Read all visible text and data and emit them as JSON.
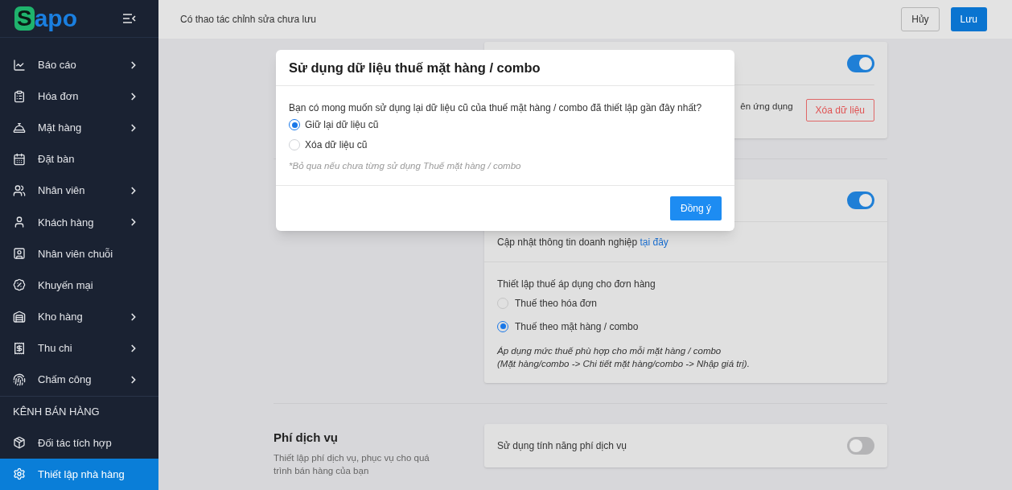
{
  "sidebar": {
    "logo": {
      "first": "S",
      "rest": "apo"
    },
    "items": [
      {
        "label": "Báo cáo",
        "has_submenu": true,
        "selected": false
      },
      {
        "label": "Hóa đơn",
        "has_submenu": true,
        "selected": false
      },
      {
        "label": "Mặt hàng",
        "has_submenu": true,
        "selected": false
      },
      {
        "label": "Đặt bàn",
        "has_submenu": false,
        "selected": false
      },
      {
        "label": "Nhân viên",
        "has_submenu": true,
        "selected": false
      },
      {
        "label": "Khách hàng",
        "has_submenu": true,
        "selected": false
      },
      {
        "label": "Nhân viên chuỗi",
        "has_submenu": false,
        "selected": false
      },
      {
        "label": "Khuyến mại",
        "has_submenu": false,
        "selected": false
      },
      {
        "label": "Kho hàng",
        "has_submenu": true,
        "selected": false
      },
      {
        "label": "Thu chi",
        "has_submenu": true,
        "selected": false
      },
      {
        "label": "Chấm công",
        "has_submenu": true,
        "selected": false
      }
    ],
    "section_label": "KÊNH BÁN HÀNG",
    "channel_items": [
      {
        "label": "Đối tác tích hợp",
        "has_submenu": false,
        "selected": false
      },
      {
        "label": "Thiết lập nhà hàng",
        "has_submenu": false,
        "selected": true
      }
    ]
  },
  "top_bar": {
    "message": "Có thao tác chỉnh sửa chưa lưu",
    "cancel": "Hủy",
    "save": "Lưu"
  },
  "card_1": {
    "toggle_on": true,
    "row_text": "ên ứng dụng",
    "button": "Xóa dữ liệu"
  },
  "card_2": {
    "toggle_on": true,
    "update_text": "Cập nhật thông tin doanh nghiệp",
    "update_link": "tại đây",
    "tax_label": "Thiết lập thuế áp dụng cho đơn hàng",
    "tax_options": [
      {
        "label": "Thuế theo hóa đơn",
        "selected": false
      },
      {
        "label": "Thuế theo mặt hàng / combo",
        "selected": true
      }
    ],
    "note_lines": [
      "Áp dụng mức thuế phù hợp cho mỗi mặt hàng / combo",
      "(Mặt hàng/combo -> Chi tiết mặt hàng/combo -> Nhập giá trị)."
    ]
  },
  "service_fee": {
    "title": "Phí dịch vụ",
    "description": "Thiết lập phí dịch vụ, phục vụ cho quá trình bán hàng của bạn",
    "setting": "Sử dụng tính năng phí dịch vụ",
    "toggle_on": false
  },
  "modal": {
    "title": "Sử dụng dữ liệu thuế mặt hàng / combo",
    "question": "Bạn có mong muốn sử dụng lại dữ liệu cũ của thuế mặt hàng / combo đã thiết lập gần đây nhất?",
    "options": [
      {
        "label": "Giữ lại dữ liệu cũ",
        "selected": true
      },
      {
        "label": "Xóa dữ liệu cũ",
        "selected": false
      }
    ],
    "hint": "*Bỏ qua nếu chưa từng sử dụng Thuế mặt hàng / combo",
    "confirm": "Đồng ý"
  }
}
